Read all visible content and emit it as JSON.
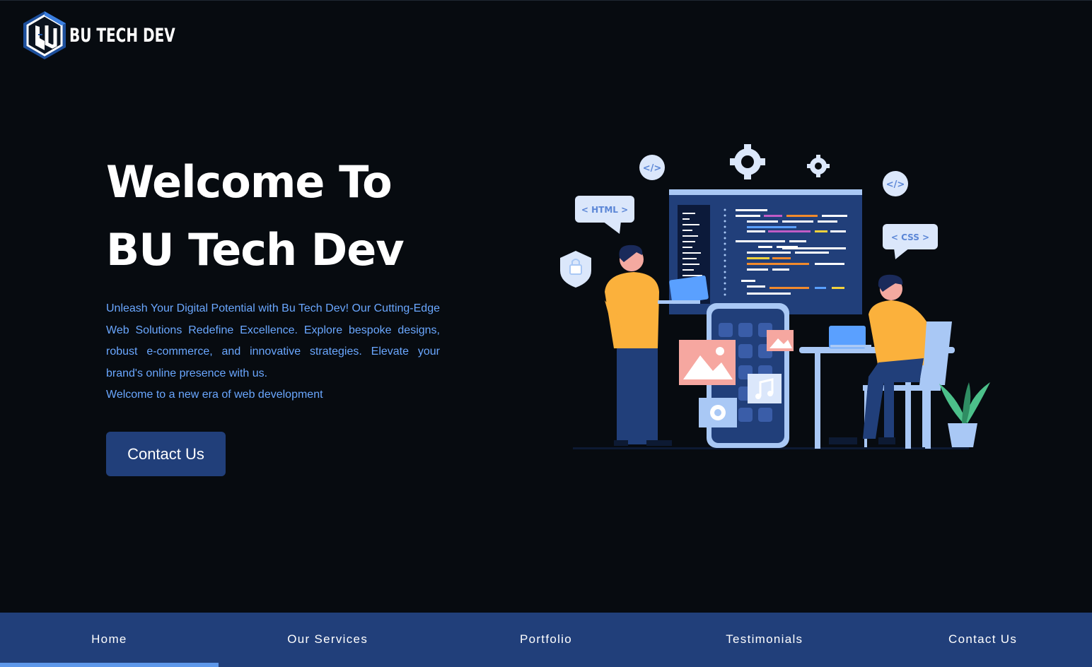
{
  "brand": {
    "name": "BU TECH DEV",
    "logo_icon": "bu-hexagon-logo"
  },
  "hero": {
    "title_line1": "Welcome To",
    "title_line2": "BU Tech Dev",
    "description": "Unleash Your Digital Potential with Bu Tech Dev! Our Cutting-Edge Web Solutions Redefine Excellence. Explore bespoke designs, robust e-commerce, and innovative strategies. Elevate your brand's online presence with us.",
    "description_last": "Welcome to a new era of web development",
    "cta_label": "Contact Us"
  },
  "illustration": {
    "html_tag": "< HTML >",
    "css_tag": "< CSS >",
    "code_icon": "</>"
  },
  "nav": {
    "items": [
      {
        "label": "Home",
        "active": true
      },
      {
        "label": "Our Services",
        "active": false
      },
      {
        "label": "Portfolio",
        "active": false
      },
      {
        "label": "Testimonials",
        "active": false
      },
      {
        "label": "Contact Us",
        "active": false
      }
    ]
  },
  "colors": {
    "background": "#070b10",
    "accent_navy": "#213f7a",
    "accent_blue": "#6aa7ff",
    "active_indicator": "#5e98ea",
    "illustration_orange": "#fbb13c",
    "illustration_light_blue": "#a9c8f5"
  }
}
